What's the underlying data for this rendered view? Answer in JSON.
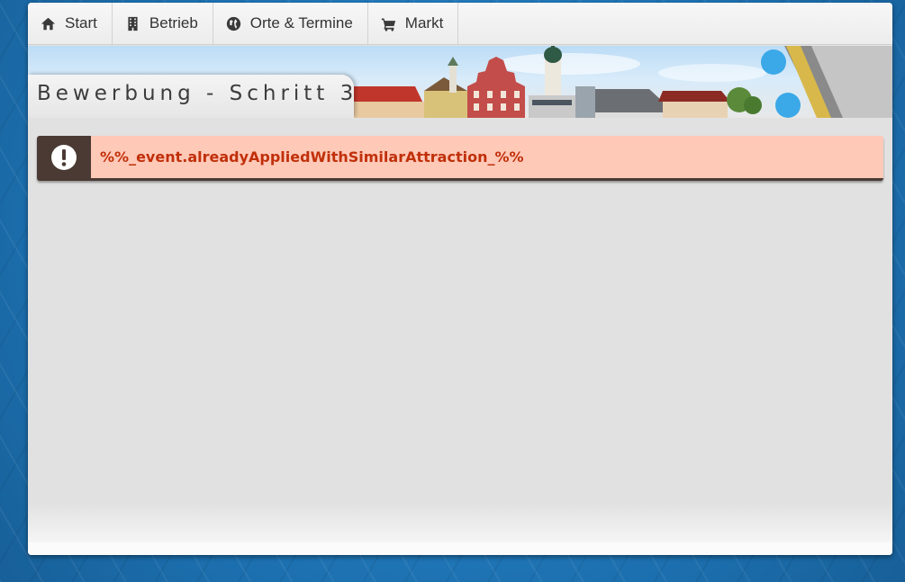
{
  "nav": {
    "items": [
      {
        "label": "Start",
        "icon": "home-icon"
      },
      {
        "label": "Betrieb",
        "icon": "building-icon"
      },
      {
        "label": "Orte & Termine",
        "icon": "globe-icon"
      },
      {
        "label": "Markt",
        "icon": "cart-icon"
      }
    ]
  },
  "page": {
    "title": "Bewerbung - Schritt 3"
  },
  "alert": {
    "icon": "exclamation-circle-icon",
    "message": "%%_event.alreadyAppliedWithSimilarAttraction_%%",
    "colors": {
      "background": "#ffc9b8",
      "text": "#c0300a",
      "icon_box": "#4a3a33"
    }
  }
}
